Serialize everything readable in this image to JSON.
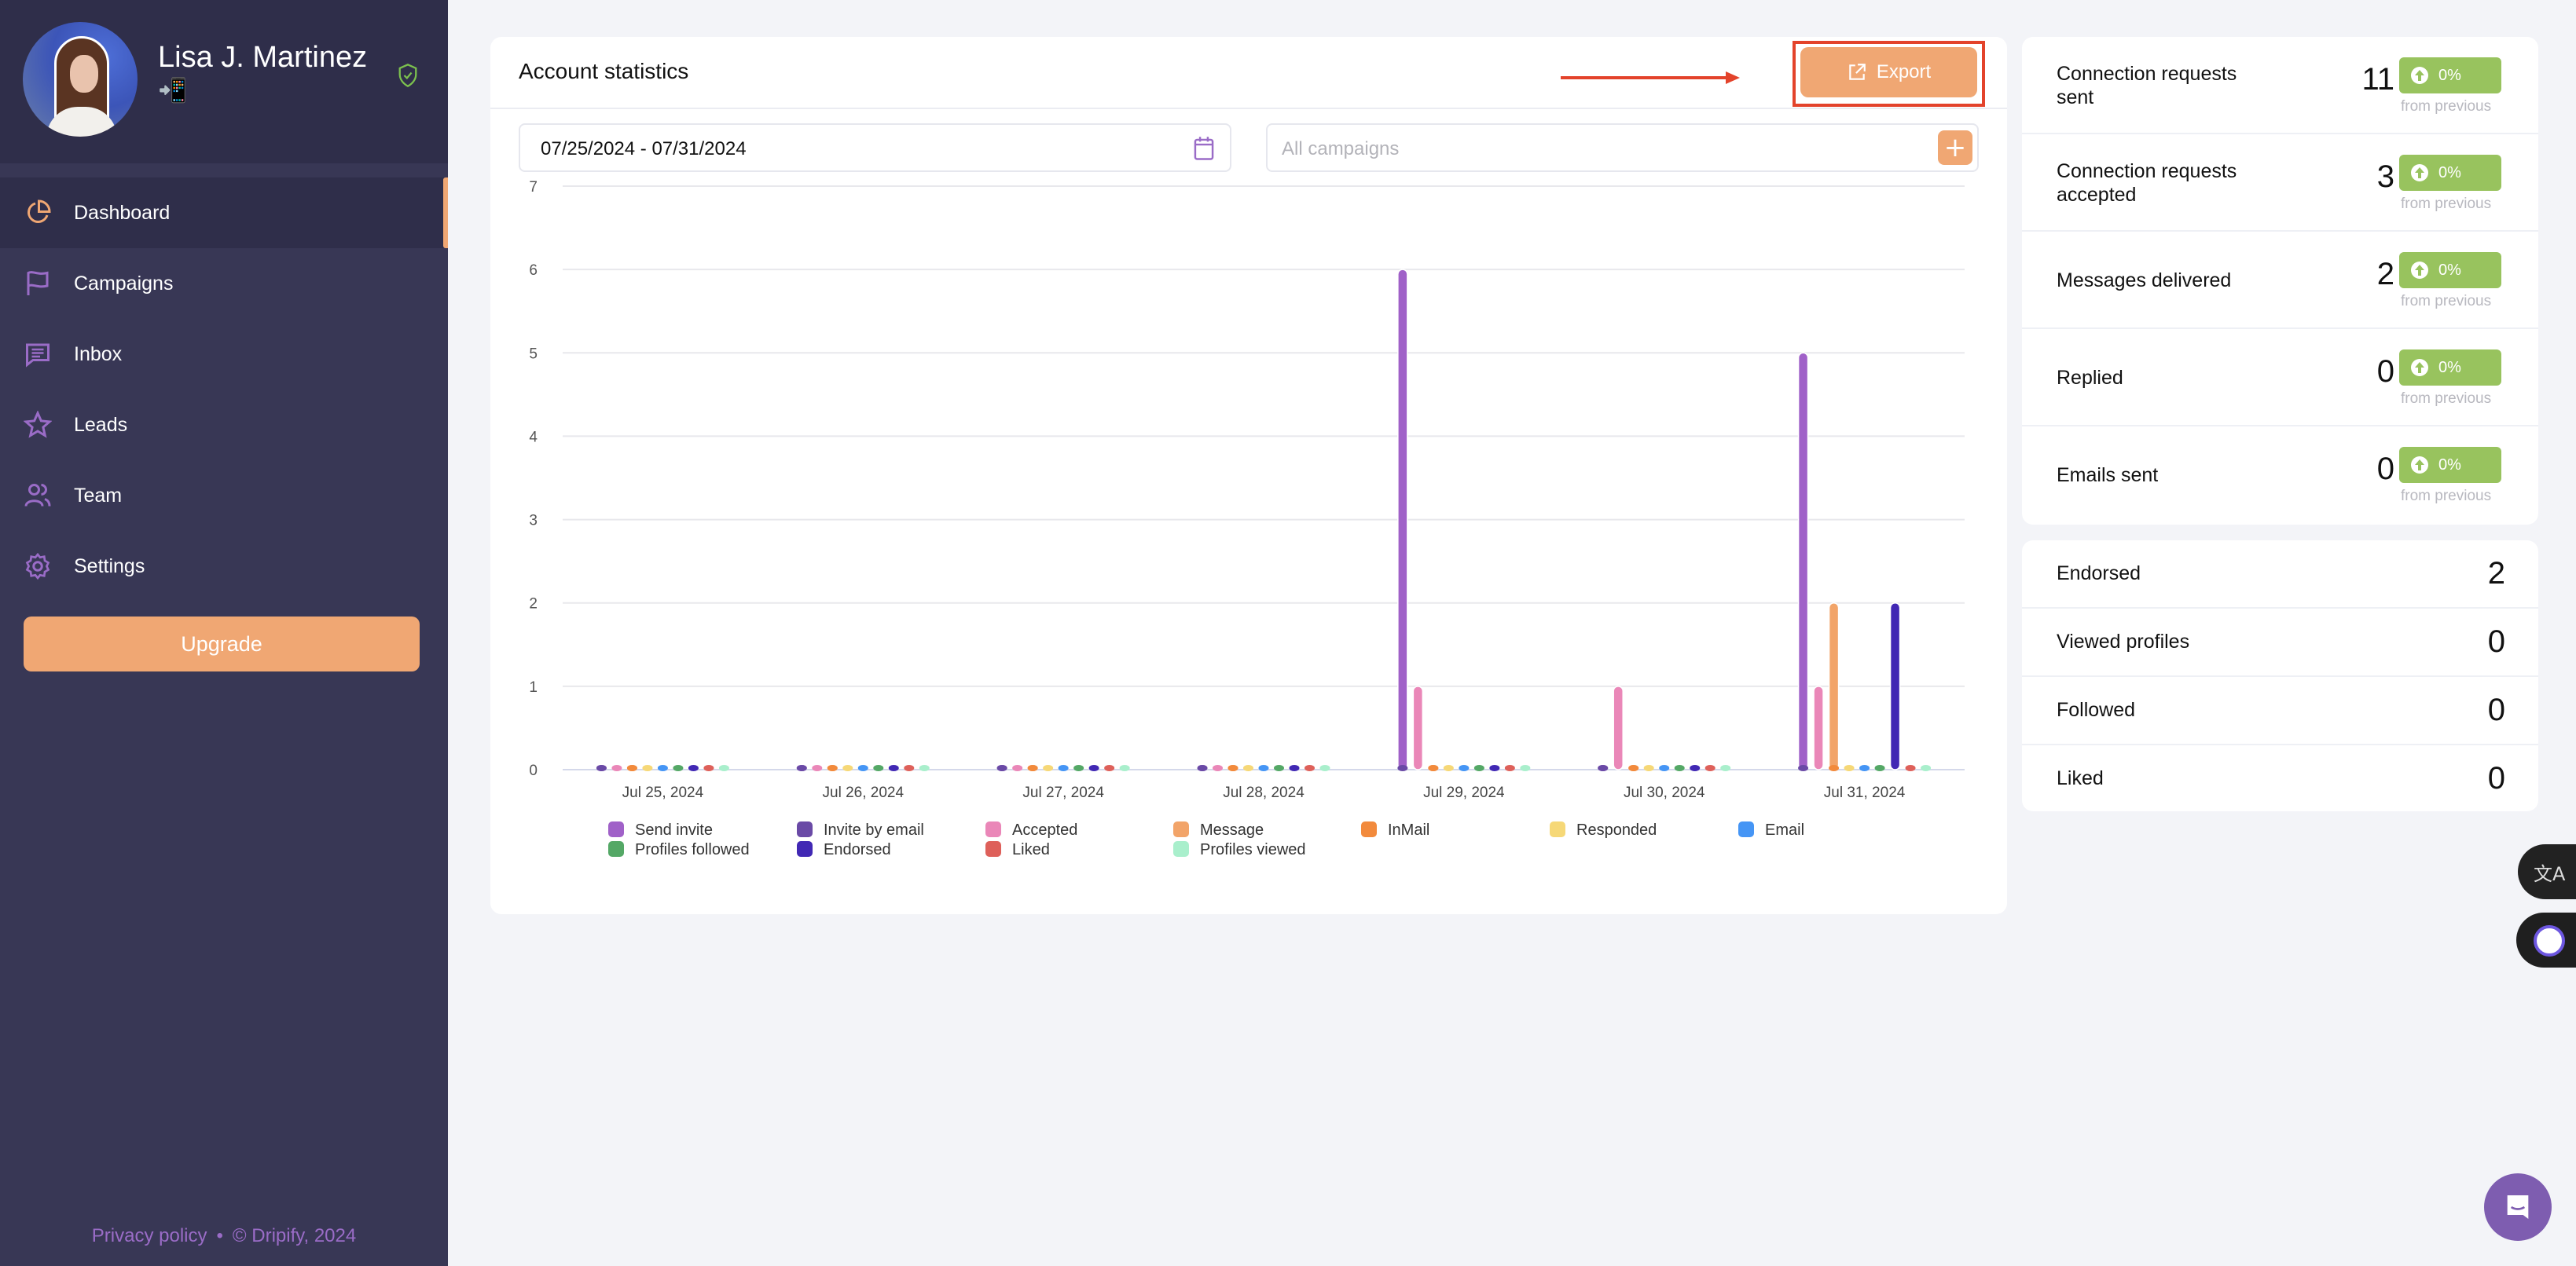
{
  "user": {
    "name": "Lisa J. Martinez",
    "status_emoji": "📲",
    "verified_icon": "shield-check-icon"
  },
  "sidebar": {
    "items": [
      {
        "label": "Dashboard",
        "icon": "pie-chart-icon",
        "active": true
      },
      {
        "label": "Campaigns",
        "icon": "flag-icon",
        "active": false
      },
      {
        "label": "Inbox",
        "icon": "message-icon",
        "active": false
      },
      {
        "label": "Leads",
        "icon": "star-icon",
        "active": false
      },
      {
        "label": "Team",
        "icon": "users-icon",
        "active": false
      },
      {
        "label": "Settings",
        "icon": "gear-icon",
        "active": false
      }
    ],
    "upgrade_label": "Upgrade",
    "footer": {
      "privacy": "Privacy policy",
      "separator": "•",
      "copyright": "© Dripify, 2024"
    }
  },
  "stats": {
    "title": "Account statistics",
    "export_label": "Export",
    "date_range": "07/25/2024  - 07/31/2024",
    "campaign_placeholder": "All campaigns",
    "add_label": "+"
  },
  "kpis": [
    {
      "label": "Connection requests sent",
      "value": "11",
      "change": "0%",
      "note": "from previous"
    },
    {
      "label": "Connection requests accepted",
      "value": "3",
      "change": "0%",
      "note": "from previous"
    },
    {
      "label": "Messages delivered",
      "value": "2",
      "change": "0%",
      "note": "from previous"
    },
    {
      "label": "Replied",
      "value": "0",
      "change": "0%",
      "note": "from previous"
    },
    {
      "label": "Emails sent",
      "value": "0",
      "change": "0%",
      "note": "from previous"
    }
  ],
  "counts": [
    {
      "label": "Endorsed",
      "value": "2"
    },
    {
      "label": "Viewed profiles",
      "value": "0"
    },
    {
      "label": "Followed",
      "value": "0"
    },
    {
      "label": "Liked",
      "value": "0"
    }
  ],
  "colors": {
    "accent": "#f0a773",
    "sidebar_bg": "#383755",
    "sidebar_header_bg": "#2f2e4a",
    "badge_green": "#98c35e",
    "annotation_red": "#e3432b"
  },
  "chart_data": {
    "type": "bar",
    "title": "",
    "xlabel": "",
    "ylabel": "",
    "ylim": [
      0,
      7
    ],
    "yticks": [
      0,
      1,
      2,
      3,
      4,
      5,
      6,
      7
    ],
    "grid": true,
    "legend_position": "bottom",
    "categories": [
      "Jul 25, 2024",
      "Jul 26, 2024",
      "Jul 27, 2024",
      "Jul 28, 2024",
      "Jul 29, 2024",
      "Jul 30, 2024",
      "Jul 31, 2024"
    ],
    "series": [
      {
        "name": "Send invite",
        "color": "#a061c8",
        "values": [
          0,
          0,
          0,
          0,
          6,
          0,
          5
        ]
      },
      {
        "name": "Invite by email",
        "color": "#6a4aa6",
        "values": [
          0,
          0,
          0,
          0,
          0,
          0,
          0
        ]
      },
      {
        "name": "Accepted",
        "color": "#ea87b8",
        "values": [
          0,
          0,
          0,
          0,
          1,
          1,
          1
        ]
      },
      {
        "name": "Message",
        "color": "#f2a469",
        "values": [
          0,
          0,
          0,
          0,
          0,
          0,
          2
        ]
      },
      {
        "name": "InMail",
        "color": "#f28a3c",
        "values": [
          0,
          0,
          0,
          0,
          0,
          0,
          0
        ]
      },
      {
        "name": "Responded",
        "color": "#f6d877",
        "values": [
          0,
          0,
          0,
          0,
          0,
          0,
          0
        ]
      },
      {
        "name": "Email",
        "color": "#4595f5",
        "values": [
          0,
          0,
          0,
          0,
          0,
          0,
          0
        ]
      },
      {
        "name": "Profiles followed",
        "color": "#54a866",
        "values": [
          0,
          0,
          0,
          0,
          0,
          0,
          0
        ]
      },
      {
        "name": "Endorsed",
        "color": "#4128b4",
        "values": [
          0,
          0,
          0,
          0,
          0,
          0,
          2
        ]
      },
      {
        "name": "Liked",
        "color": "#de605a",
        "values": [
          0,
          0,
          0,
          0,
          0,
          0,
          0
        ]
      },
      {
        "name": "Profiles viewed",
        "color": "#a9efcc",
        "values": [
          0,
          0,
          0,
          0,
          0,
          0,
          0
        ]
      }
    ]
  }
}
